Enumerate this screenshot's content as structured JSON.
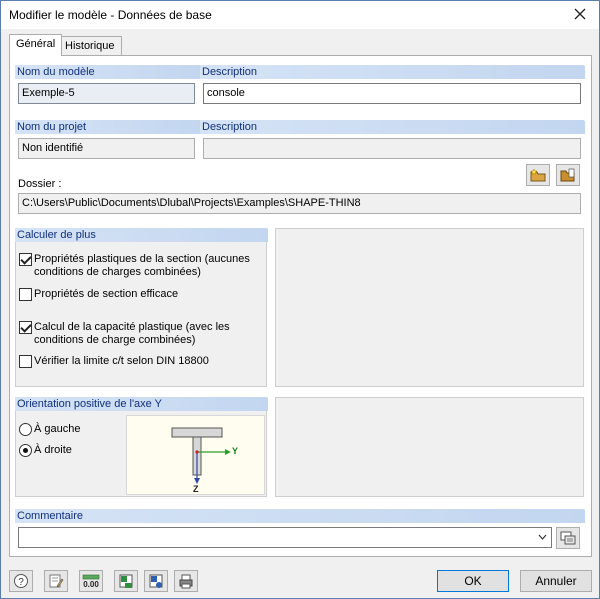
{
  "window": {
    "title": "Modifier le modèle - Données de base"
  },
  "tabs": [
    {
      "label": "Général",
      "active": true
    },
    {
      "label": "Historique",
      "active": false
    }
  ],
  "model": {
    "header_name": "Nom du modèle",
    "header_description": "Description",
    "name_value": "Exemple-5",
    "description_value": "console"
  },
  "project": {
    "header_name": "Nom du projet",
    "header_description": "Description",
    "name_value": "Non identifié",
    "description_value": ""
  },
  "folder": {
    "label": "Dossier :",
    "path": "C:\\Users\\Public\\Documents\\Dlubal\\Projects\\Examples\\SHAPE-THIN8"
  },
  "calc": {
    "header": "Calculer de plus",
    "options": [
      {
        "label_line1": "Propriétés plastiques de la section (aucunes",
        "label_line2": "conditions de charges combinées)",
        "checked": true
      },
      {
        "label_line1": "Propriétés de section efficace",
        "label_line2": "",
        "checked": false
      },
      {
        "label_line1": "Calcul de la capacité plastique (avec les",
        "label_line2": "conditions de charge combinées)",
        "checked": true
      },
      {
        "label_line1": "Vérifier la limite c/t selon DIN 18800",
        "label_line2": "",
        "checked": false
      }
    ]
  },
  "orientation": {
    "header": "Orientation positive de l'axe Y",
    "options": [
      {
        "label": "À gauche",
        "checked": false
      },
      {
        "label": "À droite",
        "checked": true
      }
    ],
    "axis_y": "Y",
    "axis_z": "Z"
  },
  "comment": {
    "header": "Commentaire",
    "value": ""
  },
  "footer": {
    "ok_label": "OK",
    "cancel_label": "Annuler"
  },
  "colors": {
    "section_header_bg": "#c3d6f0",
    "section_header_text": "#10307a",
    "accent": "#0078d7"
  }
}
